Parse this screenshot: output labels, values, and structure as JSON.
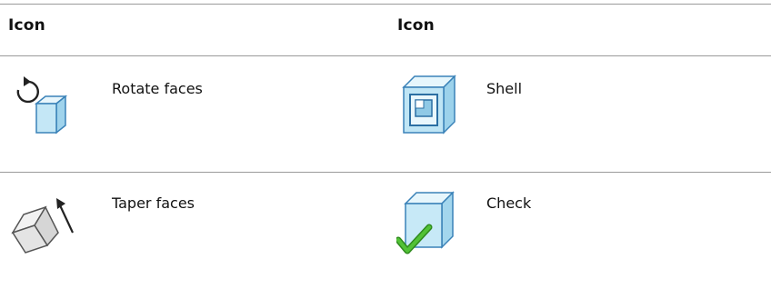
{
  "table": {
    "headers": [
      "Icon",
      "Icon"
    ],
    "rows": [
      {
        "left": {
          "icon": "rotate-faces-icon",
          "label": "Rotate faces"
        },
        "right": {
          "icon": "shell-icon",
          "label": "Shell"
        }
      },
      {
        "left": {
          "icon": "taper-faces-icon",
          "label": "Taper faces"
        },
        "right": {
          "icon": "check-icon",
          "label": "Check"
        }
      }
    ]
  },
  "colors": {
    "cube_face_light": "#dff3fb",
    "cube_face_mid": "#aedcf0",
    "cube_edge": "#3a82b8",
    "check_green": "#43a62a",
    "rule_gray": "#9a9a9a"
  }
}
